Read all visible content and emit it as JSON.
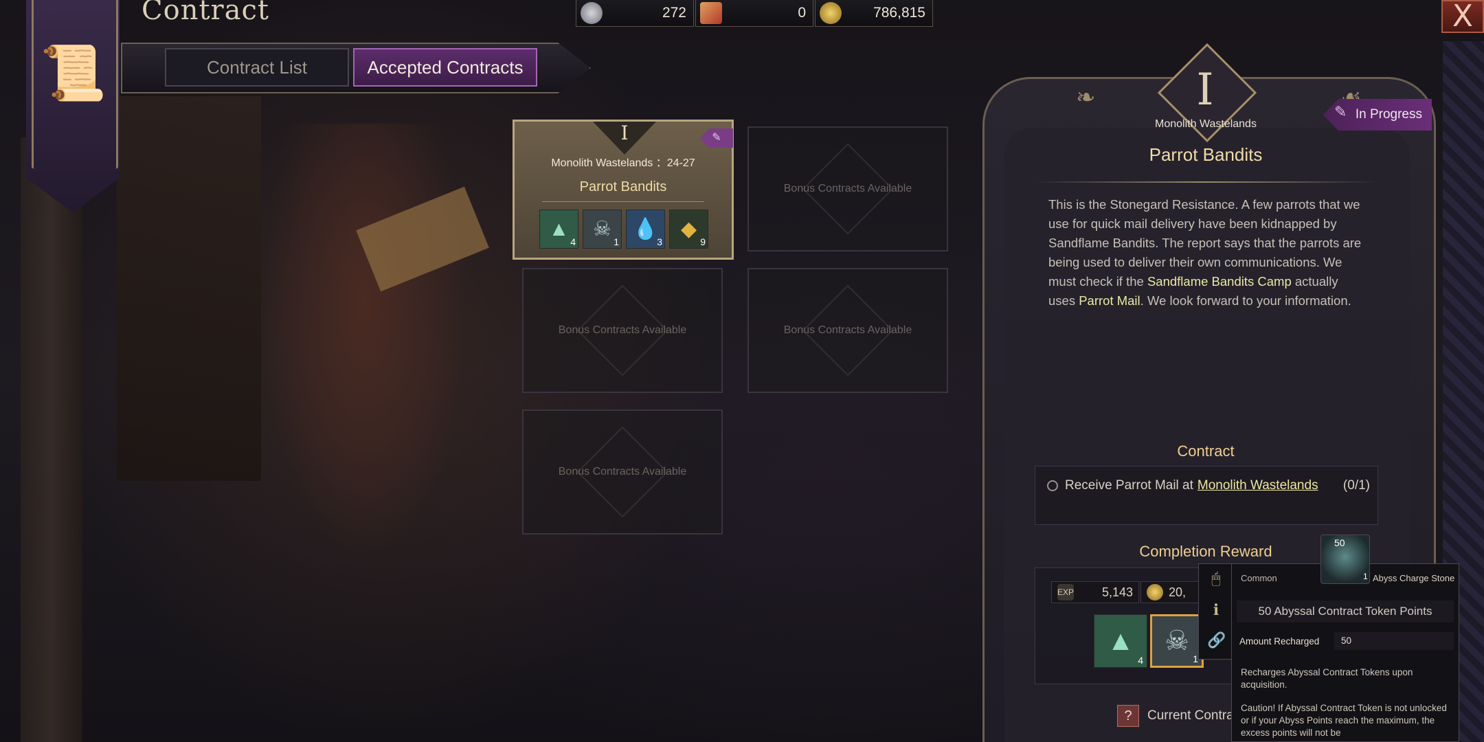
{
  "header": {
    "title": "Contract",
    "close_label": "X",
    "currencies": [
      {
        "icon": "silver-coin-icon",
        "value": "272",
        "color": "#9a9aa3"
      },
      {
        "icon": "red-ticket-icon",
        "value": "0",
        "color": "#c4533c"
      },
      {
        "icon": "gold-coin-icon",
        "value": "786,815",
        "color": "#caa33a"
      }
    ]
  },
  "tabs": [
    {
      "label": "Contract List",
      "selected": false
    },
    {
      "label": "Accepted Contracts",
      "selected": true
    }
  ],
  "contracts": {
    "active": {
      "tier": "I",
      "region": "Monolith Wastelands ：24-27",
      "name": "Parrot Bandits",
      "rewards": [
        {
          "icon": "crystal-pile-icon",
          "count": "4",
          "color": "#2f5b47"
        },
        {
          "icon": "abyss-charge-stone-icon",
          "count": "1",
          "color": "#3b4447"
        },
        {
          "icon": "water-drop-icon",
          "count": "3",
          "color": "#2d4767"
        },
        {
          "icon": "gold-ore-icon",
          "count": "9",
          "color": "#2d3a2b"
        }
      ]
    },
    "bonus_label": "Bonus Contracts Available"
  },
  "detail": {
    "tier": "I",
    "region": "Monolith Wastelands",
    "status": "In Progress",
    "title": "Parrot Bandits",
    "description": {
      "p1": "This is the Stonegard Resistance. A few parrots that we use for quick mail delivery have been kidnapped by Sandflame Bandits. The report says that the parrots are being used to deliver their own communications. We must check if the ",
      "h1": "Sandflame Bandits Camp",
      "p2": " actually uses ",
      "h2": "Parrot Mail",
      "p3": ". We look forward to your information."
    },
    "contract_heading": "Contract",
    "objective": {
      "text": "Receive Parrot Mail at",
      "link": "Monolith Wastelands",
      "progress": "(0/1)"
    },
    "reward_heading": "Completion Reward",
    "exp_label": "EXP",
    "exp_value": "5,143",
    "gold_value": "20,",
    "reward_items": [
      {
        "icon": "crystal-pile-icon",
        "count": "4"
      },
      {
        "icon": "abyss-charge-stone-icon",
        "count": "1"
      }
    ],
    "current_label": "Current Contra"
  },
  "tooltip": {
    "rarity": "Common",
    "item_name": "Abyss Charge Stone",
    "stone_badge": "50",
    "stone_count": "1",
    "headline": "50 Abyssal Contract Token Points",
    "stat_label": "Amount Recharged",
    "stat_value": "50",
    "body": "Recharges Abyssal Contract Tokens upon acquisition.",
    "warning": "Caution! If Abyssal Contract Token is not unlocked or if your Abyss Points reach the maximum, the excess points will not be"
  }
}
